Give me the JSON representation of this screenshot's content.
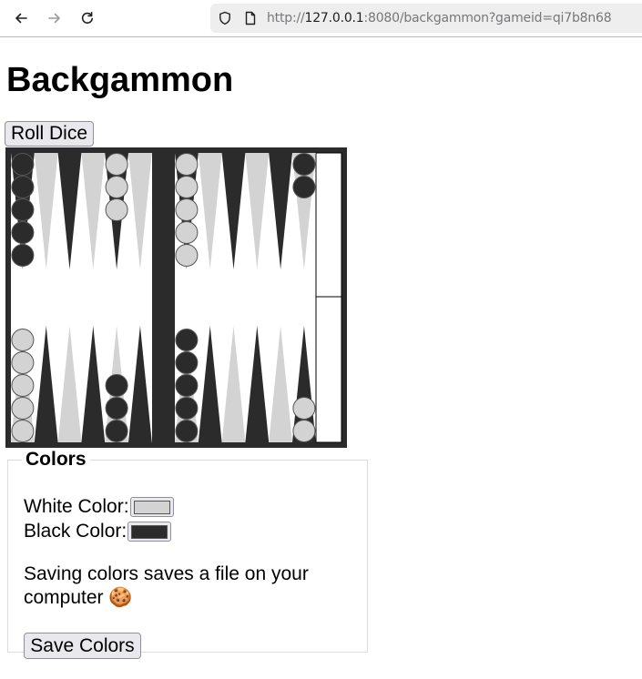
{
  "browser": {
    "url_prefix": "http://",
    "url_host": "127.0.0.1",
    "url_rest": ":8080/backgammon?gameid=qi7b8n68"
  },
  "page": {
    "title": "Backgammon",
    "roll_button": "Roll Dice"
  },
  "board": {
    "colors": {
      "frame": "#2b2b2b",
      "light": "#d3d3d3",
      "dark": "#2b2b2b",
      "field": "#ffffff"
    },
    "top_points": [
      {
        "checkers": 5,
        "color": "black"
      },
      {
        "checkers": 0,
        "color": ""
      },
      {
        "checkers": 0,
        "color": ""
      },
      {
        "checkers": 0,
        "color": ""
      },
      {
        "checkers": 3,
        "color": "white"
      },
      {
        "checkers": 0,
        "color": ""
      },
      {
        "checkers": 5,
        "color": "white"
      },
      {
        "checkers": 0,
        "color": ""
      },
      {
        "checkers": 0,
        "color": ""
      },
      {
        "checkers": 0,
        "color": ""
      },
      {
        "checkers": 0,
        "color": ""
      },
      {
        "checkers": 2,
        "color": "black"
      }
    ],
    "bottom_points": [
      {
        "checkers": 5,
        "color": "white"
      },
      {
        "checkers": 0,
        "color": ""
      },
      {
        "checkers": 0,
        "color": ""
      },
      {
        "checkers": 0,
        "color": ""
      },
      {
        "checkers": 3,
        "color": "black"
      },
      {
        "checkers": 0,
        "color": ""
      },
      {
        "checkers": 5,
        "color": "black"
      },
      {
        "checkers": 0,
        "color": ""
      },
      {
        "checkers": 0,
        "color": ""
      },
      {
        "checkers": 0,
        "color": ""
      },
      {
        "checkers": 0,
        "color": ""
      },
      {
        "checkers": 2,
        "color": "white"
      }
    ]
  },
  "colors_panel": {
    "legend": "Colors",
    "white_label": "White Color:",
    "white_value": "#d3d3d3",
    "black_label": "Black Color:",
    "black_value": "#2b2b2b",
    "note": "Saving colors saves a file on your computer 🍪",
    "save_button": "Save Colors"
  }
}
